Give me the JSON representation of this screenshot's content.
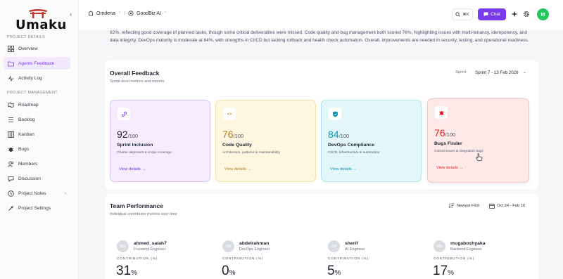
{
  "app": {
    "logo_text": "Umaku"
  },
  "sidebar": {
    "sections": [
      {
        "label": "PROJECT DETAILS"
      },
      {
        "label": "PROJECT MANAGEMENT"
      }
    ],
    "details_items": [
      {
        "label": "Overview",
        "icon": "grid-icon"
      },
      {
        "label": "Agents Feedback",
        "icon": "folder-icon",
        "active": true
      },
      {
        "label": "Activity Log",
        "icon": "activity-icon"
      }
    ],
    "management_items": [
      {
        "label": "Roadmap",
        "icon": "roadmap-icon"
      },
      {
        "label": "Backlog",
        "icon": "backlog-icon"
      },
      {
        "label": "Kanban",
        "icon": "kanban-icon"
      },
      {
        "label": "Bugs",
        "icon": "bug-icon"
      },
      {
        "label": "Members",
        "icon": "members-icon"
      },
      {
        "label": "Discussion",
        "icon": "discussion-icon"
      },
      {
        "label": "Project Notes",
        "icon": "notes-icon",
        "has_chevron": true
      },
      {
        "label": "Project Settings",
        "icon": "settings-icon"
      }
    ]
  },
  "topbar": {
    "collapse_glyph": "‹",
    "breadcrumb": [
      {
        "label": "Omdena"
      },
      {
        "label": "GoodBiz AI"
      }
    ],
    "breadcrumb_separator": "/",
    "search_shortcut": "⌘K",
    "chat_label": "Chat",
    "user_initial": "M",
    "accent_color": "#7c3aed"
  },
  "intro": {
    "text": "92%, reflecting good coverage of planned tasks, though some critical deliverables were missed. Code quality and bug management both scored 76%, highlighting issues with multi-tenancy, idempotency, and data integrity. DevOps maturity is moderate at 84%, with strengths in CI/CD but lacking rollback and health check automation. Overall, improvements are needed in security, testing, and operational readiness."
  },
  "feedback": {
    "title": "Overall Feedback",
    "subtitle": "Sprint-level metrics and reports",
    "sprint_label": "Sprint:",
    "sprint_value": "Sprint 7 - 13 Feb 2026",
    "cards": [
      {
        "score": "92",
        "out_of": "/100",
        "title": "Sprint Inclusion",
        "desc": "Charter alignment & scope coverage",
        "link": "View details",
        "icon": "link-icon",
        "color": "#7c3aed",
        "bg": "#f5edff",
        "border": "#d8c2f6"
      },
      {
        "score": "76",
        "out_of": "/100",
        "title": "Code Quality",
        "desc": "Architecture, patterns & maintainability",
        "link": "View details",
        "icon": "code-icon",
        "color": "#b7791f",
        "bg": "#fff6df",
        "border": "#f4dfa6"
      },
      {
        "score": "84",
        "out_of": "/100",
        "title": "DevOps Compliance",
        "desc": "CI/CD, infrastructure & automation",
        "link": "View details",
        "icon": "shield-icon",
        "color": "#0891b2",
        "bg": "#e3f7fb",
        "border": "#b3e4ef"
      },
      {
        "score": "76",
        "out_of": "/100",
        "title": "Bugs Finder",
        "desc": "Critical issues & integration bugs",
        "link": "View details",
        "icon": "bug-icon",
        "color": "#dc2626",
        "bg": "#fde9e7",
        "border": "#f5c6c0"
      }
    ]
  },
  "team": {
    "title": "Team Performance",
    "subtitle": "Individual contributor metrics over time",
    "sort_label": "Newest First",
    "date_range": "Oct 24 - Feb 16",
    "contribution_label": "CONTRIBUTION (%)",
    "members": [
      {
        "initials": "AH",
        "name": "ahmed_salah7",
        "role": "Frontend Engineer",
        "value": "31",
        "unit": "%"
      },
      {
        "initials": "AB",
        "name": "abdelrahman",
        "role": "DevOps Engineer",
        "value": "0",
        "unit": "%"
      },
      {
        "initials": "SH",
        "name": "sherif",
        "role": "AI Engineer",
        "value": "5",
        "unit": "%"
      },
      {
        "initials": "MU",
        "name": "mugaboshyaka",
        "role": "Backend Engineer",
        "value": "17",
        "unit": "%"
      }
    ]
  }
}
